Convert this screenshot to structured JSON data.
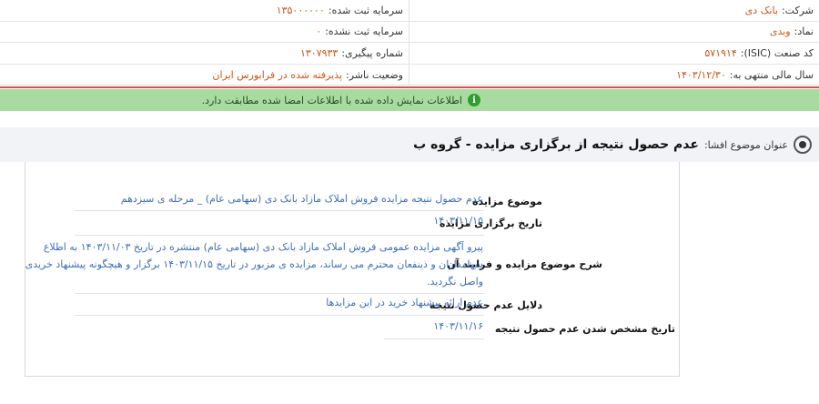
{
  "info": {
    "company_label": "شرکت:",
    "company_value": "بانک دی",
    "registered_capital_label": "سرمایه ثبت شده:",
    "registered_capital_value": "۱۳۵۰۰۰۰۰۰",
    "symbol_label": "نماد:",
    "symbol_value": "وبدی",
    "unregistered_capital_label": "سرمایه ثبت نشده:",
    "unregistered_capital_value": "۰",
    "isic_label": "کد صنعت (ISIC):",
    "isic_value": "۵۷۱۹۱۴",
    "tracking_label": "شماره پیگیری:",
    "tracking_value": "۱۳۰۷۹۳۳",
    "fiscal_year_label": "سال مالی منتهی به:",
    "fiscal_year_value": "۱۴۰۳/۱۲/۳۰",
    "publisher_status_label": "وضعیت ناشر:",
    "publisher_status_value": "پذیرفته شده در فرابورس ایران"
  },
  "notice": {
    "icon": "info-icon",
    "text": "اطلاعات نمایش داده شده با اطلاعات امضا شده مطابقت دارد."
  },
  "subject": {
    "label": "عنوان موضوع افشا:",
    "value": "عدم حصول نتیجه از برگزاری مزایده - گروه ب"
  },
  "details": {
    "auction_subject_label": "موضوع مزایده",
    "auction_subject_value": "عدم حصول نتیجه مزایده فروش املاک مازاد بانک دی (سهامی عام) _ مرحله ی سیزدهم",
    "auction_date_label": "تاریخ برگزاری مزایده",
    "auction_date_value": "۱۴۰۳/۱۱/۱۵",
    "description_label": "شرح موضوع مزایده و فرایند آن",
    "description_line1": "پیرو آگهی مزایده عمومی فروش املاک مازاد بانک دی (سهامی عام) منتشره در تاریخ ۱۴۰۳/۱۱/۰۳ به اطلاع",
    "description_line2": "سهامداران و ذینفعان محترم می رساند، مزایده ی مزبور در تاریخ ۱۴۰۳/۱۱/۱۵ برگزار و هیچگونه پیشنهاد خریدی",
    "description_line3": "واصل نگردید.",
    "reasons_label": "دلایل عدم حصول نتیجه",
    "reasons_value": "عدم ارائه پیشنهاد خرید در این مزایدها",
    "determination_date_label": "تاریخ مشخص شدن عدم حصول نتیجه",
    "determination_date_value": "۱۴۰۳/۱۱/۱۶"
  }
}
